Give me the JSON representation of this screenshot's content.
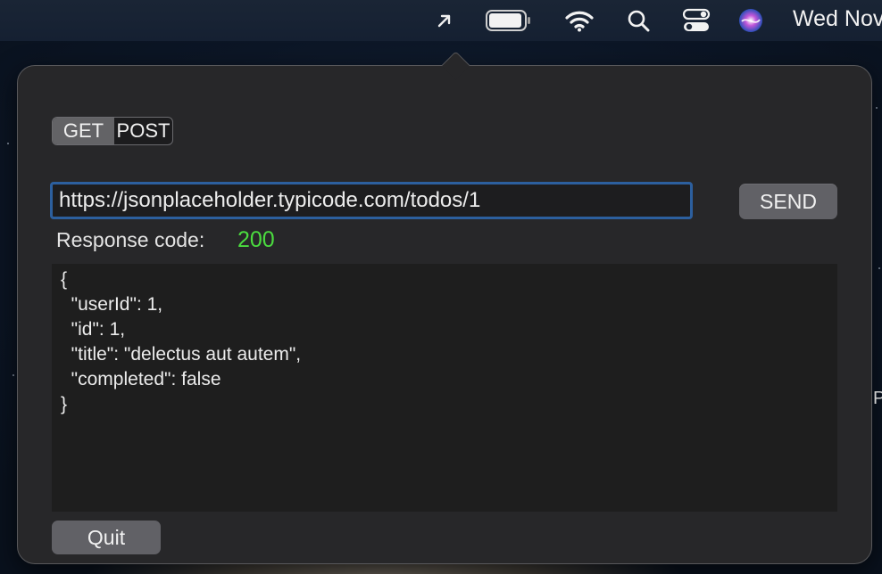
{
  "menubar": {
    "clock": "Wed Nov",
    "icons": [
      "arrow-up-right-icon",
      "battery-icon",
      "wifi-icon",
      "search-icon",
      "control-center-icon",
      "siri-icon"
    ]
  },
  "popover": {
    "method_options": [
      "GET",
      "POST"
    ],
    "selected_method": "GET",
    "url": "https://jsonplaceholder.typicode.com/todos/1",
    "send_label": "SEND",
    "response_label": "Response code:",
    "response_code": "200",
    "response_body": "{\n  \"userId\": 1,\n  \"id\": 1,\n  \"title\": \"delectus aut autem\",\n  \"completed\": false\n}",
    "quit_label": "Quit"
  },
  "desktop": {
    "edge_text": "P"
  },
  "colors": {
    "popover_bg": "#272729",
    "button_bg": "#616166",
    "focus_ring": "#2c5f9e",
    "status_ok": "#4bdc3f",
    "response_bg": "#1e1e1e"
  }
}
